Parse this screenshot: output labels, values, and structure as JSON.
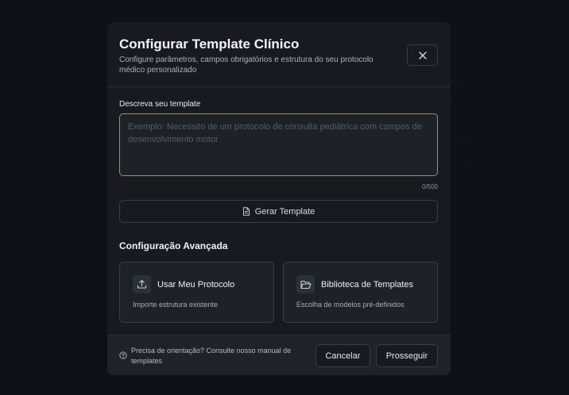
{
  "modal": {
    "title": "Configurar Template Clínico",
    "subtitle": "Configure parâmetros, campos obrigatórios e estrutura do seu protocolo médico personalizado",
    "close_icon": "close-icon"
  },
  "form": {
    "label": "Descreva seu template",
    "placeholder": "Exemplo: Necessito de um protocolo de consulta pediátrica com campos de desenvolvimento motor",
    "value": "",
    "counter": "0/500",
    "generate_label": "Gerar Template",
    "generate_icon": "document-icon"
  },
  "advanced": {
    "title": "Configuração Avançada",
    "cards": [
      {
        "title": "Usar Meu Protocolo",
        "description": "Importe estrutura existente",
        "icon": "upload-icon"
      },
      {
        "title": "Biblioteca de Templates",
        "description": "Escolha de modelos pré-definidos",
        "icon": "folder-open-icon"
      }
    ]
  },
  "footer": {
    "help_text": "Precisa de orientação? Consulte nosso manual de templates",
    "help_icon": "help-circle-icon",
    "cancel_label": "Cancelar",
    "continue_label": "Prosseguir"
  },
  "colors": {
    "accent_focus": "#c98149",
    "background": "#0e1117",
    "modal": "#171b21"
  }
}
